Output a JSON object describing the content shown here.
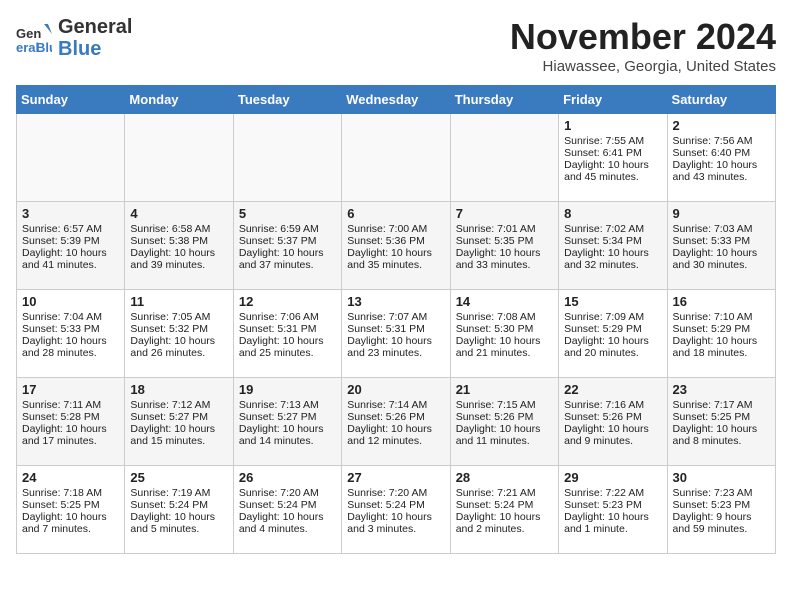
{
  "logo": {
    "line1": "General",
    "line2": "Blue"
  },
  "title": "November 2024",
  "location": "Hiawassee, Georgia, United States",
  "days_of_week": [
    "Sunday",
    "Monday",
    "Tuesday",
    "Wednesday",
    "Thursday",
    "Friday",
    "Saturday"
  ],
  "weeks": [
    [
      {
        "day": "",
        "info": ""
      },
      {
        "day": "",
        "info": ""
      },
      {
        "day": "",
        "info": ""
      },
      {
        "day": "",
        "info": ""
      },
      {
        "day": "",
        "info": ""
      },
      {
        "day": "1",
        "info": "Sunrise: 7:55 AM\nSunset: 6:41 PM\nDaylight: 10 hours and 45 minutes."
      },
      {
        "day": "2",
        "info": "Sunrise: 7:56 AM\nSunset: 6:40 PM\nDaylight: 10 hours and 43 minutes."
      }
    ],
    [
      {
        "day": "3",
        "info": "Sunrise: 6:57 AM\nSunset: 5:39 PM\nDaylight: 10 hours and 41 minutes."
      },
      {
        "day": "4",
        "info": "Sunrise: 6:58 AM\nSunset: 5:38 PM\nDaylight: 10 hours and 39 minutes."
      },
      {
        "day": "5",
        "info": "Sunrise: 6:59 AM\nSunset: 5:37 PM\nDaylight: 10 hours and 37 minutes."
      },
      {
        "day": "6",
        "info": "Sunrise: 7:00 AM\nSunset: 5:36 PM\nDaylight: 10 hours and 35 minutes."
      },
      {
        "day": "7",
        "info": "Sunrise: 7:01 AM\nSunset: 5:35 PM\nDaylight: 10 hours and 33 minutes."
      },
      {
        "day": "8",
        "info": "Sunrise: 7:02 AM\nSunset: 5:34 PM\nDaylight: 10 hours and 32 minutes."
      },
      {
        "day": "9",
        "info": "Sunrise: 7:03 AM\nSunset: 5:33 PM\nDaylight: 10 hours and 30 minutes."
      }
    ],
    [
      {
        "day": "10",
        "info": "Sunrise: 7:04 AM\nSunset: 5:33 PM\nDaylight: 10 hours and 28 minutes."
      },
      {
        "day": "11",
        "info": "Sunrise: 7:05 AM\nSunset: 5:32 PM\nDaylight: 10 hours and 26 minutes."
      },
      {
        "day": "12",
        "info": "Sunrise: 7:06 AM\nSunset: 5:31 PM\nDaylight: 10 hours and 25 minutes."
      },
      {
        "day": "13",
        "info": "Sunrise: 7:07 AM\nSunset: 5:31 PM\nDaylight: 10 hours and 23 minutes."
      },
      {
        "day": "14",
        "info": "Sunrise: 7:08 AM\nSunset: 5:30 PM\nDaylight: 10 hours and 21 minutes."
      },
      {
        "day": "15",
        "info": "Sunrise: 7:09 AM\nSunset: 5:29 PM\nDaylight: 10 hours and 20 minutes."
      },
      {
        "day": "16",
        "info": "Sunrise: 7:10 AM\nSunset: 5:29 PM\nDaylight: 10 hours and 18 minutes."
      }
    ],
    [
      {
        "day": "17",
        "info": "Sunrise: 7:11 AM\nSunset: 5:28 PM\nDaylight: 10 hours and 17 minutes."
      },
      {
        "day": "18",
        "info": "Sunrise: 7:12 AM\nSunset: 5:27 PM\nDaylight: 10 hours and 15 minutes."
      },
      {
        "day": "19",
        "info": "Sunrise: 7:13 AM\nSunset: 5:27 PM\nDaylight: 10 hours and 14 minutes."
      },
      {
        "day": "20",
        "info": "Sunrise: 7:14 AM\nSunset: 5:26 PM\nDaylight: 10 hours and 12 minutes."
      },
      {
        "day": "21",
        "info": "Sunrise: 7:15 AM\nSunset: 5:26 PM\nDaylight: 10 hours and 11 minutes."
      },
      {
        "day": "22",
        "info": "Sunrise: 7:16 AM\nSunset: 5:26 PM\nDaylight: 10 hours and 9 minutes."
      },
      {
        "day": "23",
        "info": "Sunrise: 7:17 AM\nSunset: 5:25 PM\nDaylight: 10 hours and 8 minutes."
      }
    ],
    [
      {
        "day": "24",
        "info": "Sunrise: 7:18 AM\nSunset: 5:25 PM\nDaylight: 10 hours and 7 minutes."
      },
      {
        "day": "25",
        "info": "Sunrise: 7:19 AM\nSunset: 5:24 PM\nDaylight: 10 hours and 5 minutes."
      },
      {
        "day": "26",
        "info": "Sunrise: 7:20 AM\nSunset: 5:24 PM\nDaylight: 10 hours and 4 minutes."
      },
      {
        "day": "27",
        "info": "Sunrise: 7:20 AM\nSunset: 5:24 PM\nDaylight: 10 hours and 3 minutes."
      },
      {
        "day": "28",
        "info": "Sunrise: 7:21 AM\nSunset: 5:24 PM\nDaylight: 10 hours and 2 minutes."
      },
      {
        "day": "29",
        "info": "Sunrise: 7:22 AM\nSunset: 5:23 PM\nDaylight: 10 hours and 1 minute."
      },
      {
        "day": "30",
        "info": "Sunrise: 7:23 AM\nSunset: 5:23 PM\nDaylight: 9 hours and 59 minutes."
      }
    ]
  ]
}
